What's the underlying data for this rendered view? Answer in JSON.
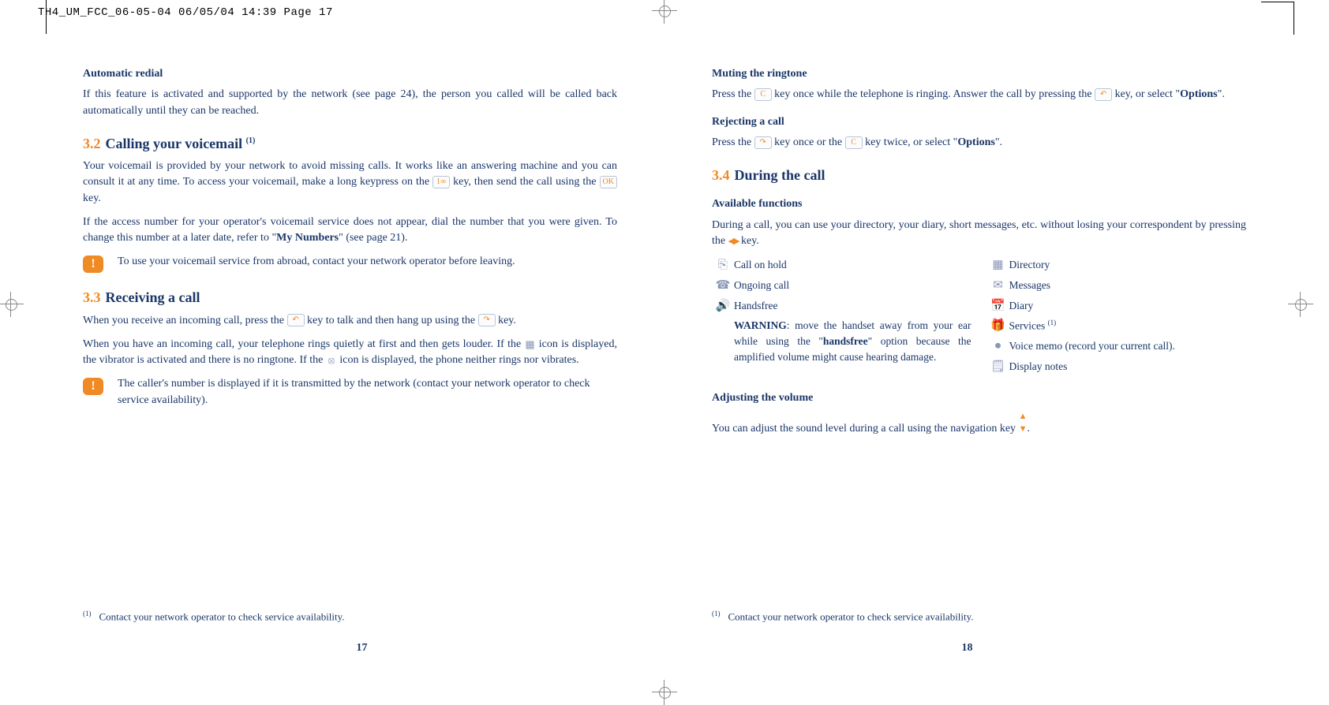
{
  "crop": {
    "header": "TH4_UM_FCC_06-05-04  06/05/04  14:39  Page 17"
  },
  "left": {
    "autoRedial": {
      "heading": "Automatic redial",
      "body": "If this feature is activated and supported by the network (see page 24), the person you called will be called back automatically until they can be reached."
    },
    "s32": {
      "num": "3.2",
      "title": "Calling your voicemail",
      "sup": "(1)",
      "p1a": "Your voicemail is provided by your network to avoid missing calls. It works like an answering machine and you can consult it at any time. To access your voicemail, make a long keypress on the ",
      "p1b": " key, then send the call using the ",
      "p1c": " key.",
      "p2a": "If the access number for your operator's voicemail service does not appear, dial the number that you were given. To change this number at a later date, refer to \"",
      "p2bold": "My Numbers",
      "p2b": "\" (see page 21).",
      "note": "To use your voicemail service from abroad, contact your network operator before leaving."
    },
    "s33": {
      "num": "3.3",
      "title": "Receiving a call",
      "p1a": "When you receive an incoming call, press the ",
      "p1b": " key to talk and then hang up using the ",
      "p1c": " key.",
      "p2a": "When you have an incoming call, your telephone rings quietly at first and then gets louder. If the ",
      "p2b": " icon is displayed, the vibrator is activated and there is no ringtone. If the ",
      "p2c": " icon is displayed, the phone neither rings nor vibrates.",
      "note": "The caller's number is displayed if it is transmitted by the network (contact your network operator to check service availability)."
    },
    "footnote": "Contact your network operator to check service availability.",
    "fnSup": "(1)",
    "pageNum": "17"
  },
  "right": {
    "muting": {
      "heading": "Muting the ringtone",
      "a": "Press the ",
      "b": " key once while the telephone is ringing. Answer the call by pressing the ",
      "c": " key, or select \"",
      "bold": "Options",
      "d": "\"."
    },
    "reject": {
      "heading": "Rejecting a call",
      "a": "Press the ",
      "b": " key once or the ",
      "c": " key twice, or select \"",
      "bold": "Options",
      "d": "\"."
    },
    "s34": {
      "num": "3.4",
      "title": "During the call"
    },
    "avail": {
      "heading": "Available functions",
      "a": "During a call, you can use your directory, your diary, short messages, etc. without losing your correspondent by pressing the ",
      "b": " key."
    },
    "funcsLeft": [
      {
        "icon": "⎘",
        "label": "Call on hold"
      },
      {
        "icon": "☎",
        "label": "Ongoing call"
      },
      {
        "icon": "🔊",
        "label": "Handsfree"
      }
    ],
    "handsfreeWarn": {
      "bold1": "WARNING",
      "a": ": move the handset away from your ear while using the \"",
      "bold2": "handsfree",
      "b": "\" option because the amplified volume might cause hearing damage."
    },
    "funcsRight": [
      {
        "icon": "▦",
        "label": "Directory"
      },
      {
        "icon": "✉",
        "label": "Messages"
      },
      {
        "icon": "📅",
        "label": "Diary"
      },
      {
        "icon": "🎁",
        "label": "Services ",
        "sup": "(1)"
      },
      {
        "icon": "⏺",
        "label": "Voice memo (record your current call)."
      },
      {
        "icon": "🗒",
        "label": "Display notes"
      }
    ],
    "adjVol": {
      "heading": "Adjusting the volume",
      "a": "You can adjust the sound level during a call using the navigation key ",
      "b": "."
    },
    "footnote": "Contact your network operator to check service availability.",
    "fnSup": "(1)",
    "pageNum": "18"
  }
}
